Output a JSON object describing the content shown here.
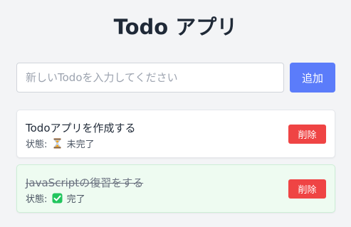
{
  "app": {
    "title": "Todo アプリ"
  },
  "input": {
    "value": "",
    "placeholder": "新しいTodoを入力してください"
  },
  "add_button": {
    "label": "追加"
  },
  "todos": [
    {
      "text": "Todoアプリを作成する",
      "status_label": "状態:",
      "status_icon": "hourglass-icon",
      "status_text": "未完了",
      "completed": false,
      "delete_label": "削除"
    },
    {
      "text": "JavaScriptの復習をする",
      "status_label": "状態:",
      "status_icon": "check-icon",
      "status_text": "完了",
      "completed": true,
      "delete_label": "削除"
    }
  ],
  "colors": {
    "accent": "#5b7cfa",
    "danger": "#ef4444",
    "completed_bg": "#eefbf1",
    "completed_border": "#cdeed6",
    "check_green": "#22c55e"
  }
}
